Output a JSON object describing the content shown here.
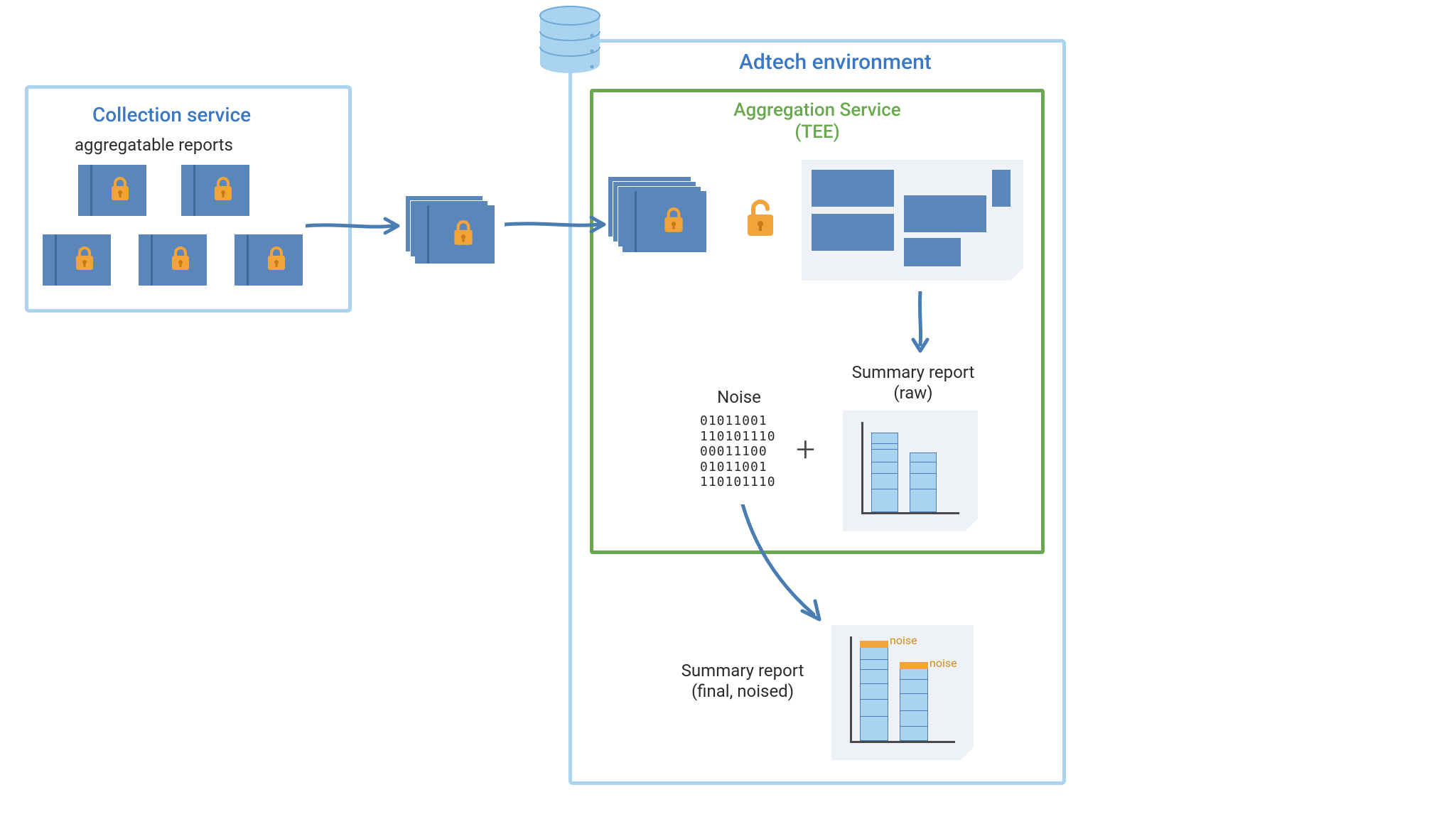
{
  "collection": {
    "title": "Collection service",
    "subtitle": "aggregatable reports"
  },
  "adtech": {
    "title": "Adtech environment"
  },
  "aggregation": {
    "title_line1": "Aggregation Service",
    "title_line2": "(TEE)"
  },
  "noise": {
    "label": "Noise",
    "bits": [
      "01011001",
      "110101110",
      "00011100",
      "01011001",
      "110101110"
    ]
  },
  "plus": "+",
  "summary_raw": {
    "label_line1": "Summary report",
    "label_line2": "(raw)"
  },
  "summary_final": {
    "label_line1": "Summary report",
    "label_line2": "(final, noised)",
    "noise_tag": "noise"
  },
  "icons": {
    "database": "database-icon",
    "locked": "lock-closed-icon",
    "unlocked": "lock-open-icon"
  },
  "colors": {
    "border_light_blue": "#a9d3ee",
    "fill_blue": "#5b86b9",
    "green": "#6aa84f",
    "title_blue": "#3b78c4",
    "orange": "#f2a33a"
  }
}
